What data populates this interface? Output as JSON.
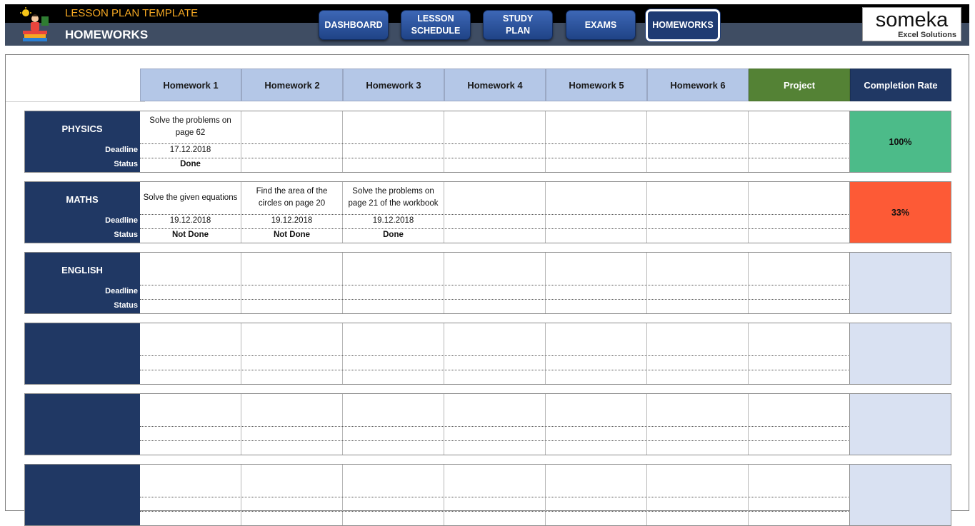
{
  "header": {
    "app_title": "LESSON PLAN TEMPLATE",
    "page_title": "HOMEWORKS",
    "brand_name": "someka",
    "brand_sub": "Excel Solutions"
  },
  "nav": [
    {
      "label": "DASHBOARD",
      "active": false
    },
    {
      "label": "LESSON\nSCHEDULE",
      "active": false
    },
    {
      "label": "STUDY\nPLAN",
      "active": false
    },
    {
      "label": "EXAMS",
      "active": false
    },
    {
      "label": "HOMEWORKS",
      "active": true
    }
  ],
  "columns": [
    "Homework 1",
    "Homework 2",
    "Homework 3",
    "Homework 4",
    "Homework 5",
    "Homework 6",
    "Project",
    "Completion Rate"
  ],
  "row_labels": {
    "deadline": "Deadline",
    "status": "Status"
  },
  "colors": {
    "rate_done": "#4cbb89",
    "rate_partial": "#fd5a36",
    "rate_empty": "#d9e1f2",
    "subject_bg": "#203864"
  },
  "subjects": [
    {
      "name": "PHYSICS",
      "show_labels": true,
      "rate": "100%",
      "rate_color": "#4cbb89",
      "tasks": [
        {
          "task": "Solve the problems on page 62",
          "deadline": "17.12.2018",
          "status": "Done"
        },
        {
          "task": "",
          "deadline": "",
          "status": ""
        },
        {
          "task": "",
          "deadline": "",
          "status": ""
        },
        {
          "task": "",
          "deadline": "",
          "status": ""
        },
        {
          "task": "",
          "deadline": "",
          "status": ""
        },
        {
          "task": "",
          "deadline": "",
          "status": ""
        },
        {
          "task": "",
          "deadline": "",
          "status": ""
        }
      ]
    },
    {
      "name": "MATHS",
      "show_labels": true,
      "rate": "33%",
      "rate_color": "#fd5a36",
      "tasks": [
        {
          "task": "Solve the given equations",
          "deadline": "19.12.2018",
          "status": "Not Done"
        },
        {
          "task": "Find the area of the circles on page 20",
          "deadline": "19.12.2018",
          "status": "Not Done"
        },
        {
          "task": "Solve the problems on page 21 of the workbook",
          "deadline": "19.12.2018",
          "status": "Done"
        },
        {
          "task": "",
          "deadline": "",
          "status": ""
        },
        {
          "task": "",
          "deadline": "",
          "status": ""
        },
        {
          "task": "",
          "deadline": "",
          "status": ""
        },
        {
          "task": "",
          "deadline": "",
          "status": ""
        }
      ]
    },
    {
      "name": "ENGLISH",
      "show_labels": true,
      "rate": "",
      "rate_color": "#d9e1f2",
      "tasks": [
        {
          "task": "",
          "deadline": "",
          "status": ""
        },
        {
          "task": "",
          "deadline": "",
          "status": ""
        },
        {
          "task": "",
          "deadline": "",
          "status": ""
        },
        {
          "task": "",
          "deadline": "",
          "status": ""
        },
        {
          "task": "",
          "deadline": "",
          "status": ""
        },
        {
          "task": "",
          "deadline": "",
          "status": ""
        },
        {
          "task": "",
          "deadline": "",
          "status": ""
        }
      ]
    },
    {
      "name": "",
      "show_labels": false,
      "rate": "",
      "rate_color": "#d9e1f2",
      "tasks": [
        {
          "task": "",
          "deadline": "",
          "status": ""
        },
        {
          "task": "",
          "deadline": "",
          "status": ""
        },
        {
          "task": "",
          "deadline": "",
          "status": ""
        },
        {
          "task": "",
          "deadline": "",
          "status": ""
        },
        {
          "task": "",
          "deadline": "",
          "status": ""
        },
        {
          "task": "",
          "deadline": "",
          "status": ""
        },
        {
          "task": "",
          "deadline": "",
          "status": ""
        }
      ]
    },
    {
      "name": "",
      "show_labels": false,
      "rate": "",
      "rate_color": "#d9e1f2",
      "tasks": [
        {
          "task": "",
          "deadline": "",
          "status": ""
        },
        {
          "task": "",
          "deadline": "",
          "status": ""
        },
        {
          "task": "",
          "deadline": "",
          "status": ""
        },
        {
          "task": "",
          "deadline": "",
          "status": ""
        },
        {
          "task": "",
          "deadline": "",
          "status": ""
        },
        {
          "task": "",
          "deadline": "",
          "status": ""
        },
        {
          "task": "",
          "deadline": "",
          "status": ""
        }
      ]
    },
    {
      "name": "",
      "show_labels": false,
      "rate": "",
      "rate_color": "#d9e1f2",
      "tasks": [
        {
          "task": "",
          "deadline": "",
          "status": ""
        },
        {
          "task": "",
          "deadline": "",
          "status": ""
        },
        {
          "task": "",
          "deadline": "",
          "status": ""
        },
        {
          "task": "",
          "deadline": "",
          "status": ""
        },
        {
          "task": "",
          "deadline": "",
          "status": ""
        },
        {
          "task": "",
          "deadline": "",
          "status": ""
        },
        {
          "task": "",
          "deadline": "",
          "status": ""
        }
      ]
    }
  ]
}
